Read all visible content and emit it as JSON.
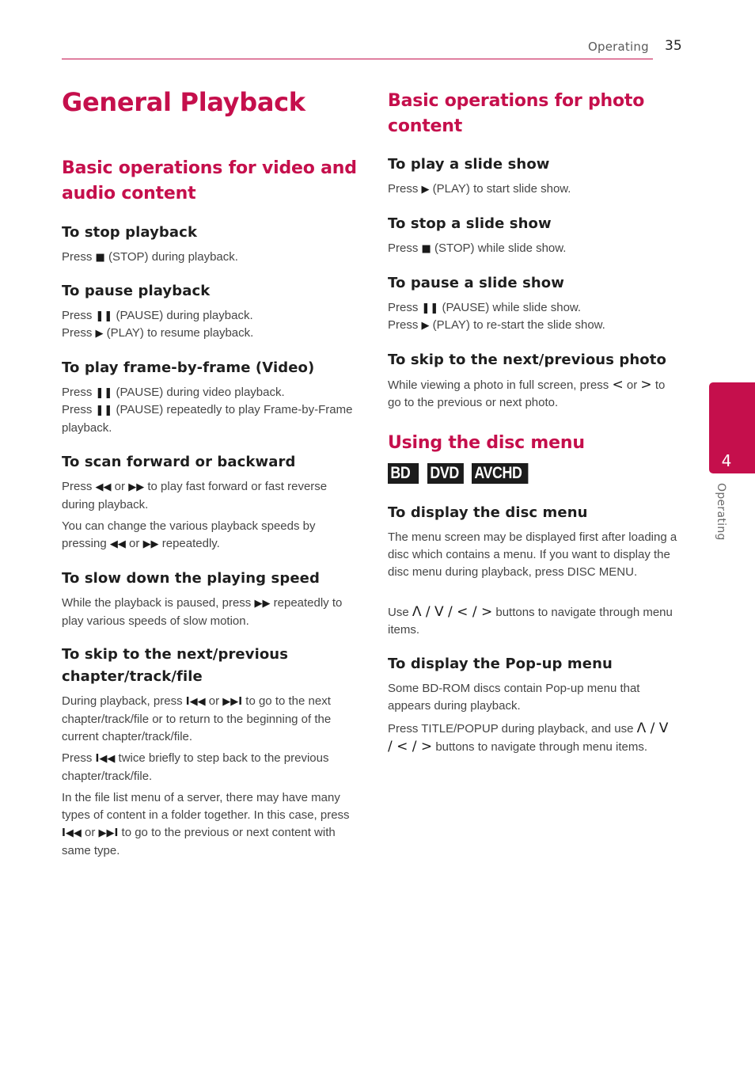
{
  "header": {
    "section": "Operating",
    "page_number": "35",
    "accent_color": "#c50f4c"
  },
  "title": "General Playback",
  "left": {
    "heading": "Basic operations for video and audio content",
    "sections": [
      {
        "title": "To stop playback",
        "paragraphs": [
          [
            {
              "t": "Press "
            },
            {
              "i": "stop-icon",
              "g": "■"
            },
            {
              "t": " (STOP) during playback."
            }
          ]
        ]
      },
      {
        "title": "To pause playback",
        "paragraphs": [
          [
            {
              "t": "Press "
            },
            {
              "i": "pause-icon",
              "g": "❚❚"
            },
            {
              "t": " (PAUSE) during playback."
            }
          ],
          [
            {
              "t": "Press "
            },
            {
              "i": "play-icon",
              "g": "▶"
            },
            {
              "t": " (PLAY) to resume playback."
            }
          ]
        ]
      },
      {
        "title": "To play frame-by-frame (Video)",
        "paragraphs": [
          [
            {
              "t": "Press "
            },
            {
              "i": "pause-icon",
              "g": "❚❚"
            },
            {
              "t": " (PAUSE) during video playback."
            }
          ],
          [
            {
              "t": "Press "
            },
            {
              "i": "pause-icon",
              "g": "❚❚"
            },
            {
              "t": " (PAUSE) repeatedly to play Frame-by-Frame playback."
            }
          ]
        ]
      },
      {
        "title": "To scan forward or backward",
        "paragraphs": [
          [
            {
              "t": "Press "
            },
            {
              "i": "rewind-icon",
              "g": "◀◀"
            },
            {
              "t": " or "
            },
            {
              "i": "fast-forward-icon",
              "g": "▶▶"
            },
            {
              "t": " to play fast forward or fast reverse during playback."
            }
          ],
          [
            {
              "t": "You can change the various playback speeds by pressing "
            },
            {
              "i": "rewind-icon",
              "g": "◀◀"
            },
            {
              "t": " or "
            },
            {
              "i": "fast-forward-icon",
              "g": "▶▶"
            },
            {
              "t": " repeatedly."
            }
          ]
        ]
      },
      {
        "title": "To slow down the playing speed",
        "paragraphs": [
          [
            {
              "t": "While the playback is paused, press "
            },
            {
              "i": "fast-forward-icon",
              "g": "▶▶"
            },
            {
              "t": " repeatedly to play various speeds of slow motion."
            }
          ]
        ]
      },
      {
        "title": "To skip to the next/previous chapter/track/file",
        "paragraphs": [
          [
            {
              "t": "During playback, press "
            },
            {
              "i": "skip-previous-icon",
              "g": "I◀◀"
            },
            {
              "t": " or "
            },
            {
              "i": "skip-next-icon",
              "g": "▶▶I"
            },
            {
              "t": " to go to the next chapter/track/file or to return to the beginning of the current chapter/track/file."
            }
          ],
          [
            {
              "t": "Press "
            },
            {
              "i": "skip-previous-icon",
              "g": "I◀◀"
            },
            {
              "t": " twice briefly to step back to the previous chapter/track/file."
            }
          ],
          [
            {
              "t": "In the file list menu of a server, there may have many types of content in a folder together. In this case, press "
            },
            {
              "i": "skip-previous-icon",
              "g": "I◀◀"
            },
            {
              "t": " or "
            },
            {
              "i": "skip-next-icon",
              "g": "▶▶I"
            },
            {
              "t": " to go to the previous or next content with same type."
            }
          ]
        ]
      }
    ]
  },
  "right": {
    "heading": "Basic operations for photo content",
    "sections": [
      {
        "title": "To play a slide show",
        "paragraphs": [
          [
            {
              "t": "Press "
            },
            {
              "i": "play-icon",
              "g": "▶"
            },
            {
              "t": " (PLAY) to start slide show."
            }
          ]
        ]
      },
      {
        "title": "To stop a slide show",
        "paragraphs": [
          [
            {
              "t": "Press "
            },
            {
              "i": "stop-icon",
              "g": "■"
            },
            {
              "t": " (STOP) while slide show."
            }
          ]
        ]
      },
      {
        "title": "To pause a slide show",
        "paragraphs": [
          [
            {
              "t": "Press "
            },
            {
              "i": "pause-icon",
              "g": "❚❚"
            },
            {
              "t": " (PAUSE) while slide show."
            }
          ],
          [
            {
              "t": "Press "
            },
            {
              "i": "play-icon",
              "g": "▶"
            },
            {
              "t": " (PLAY) to re-start the slide show."
            }
          ]
        ]
      },
      {
        "title": "To skip to the next/previous photo",
        "paragraphs": [
          [
            {
              "t": "While viewing a photo in full screen, press "
            },
            {
              "n": "left-arrow-icon",
              "g": "<"
            },
            {
              "t": " or "
            },
            {
              "n": "right-arrow-icon",
              "g": ">"
            },
            {
              "t": " to go to the previous or next photo."
            }
          ]
        ]
      }
    ],
    "disc_menu_heading": "Using the disc menu",
    "badges": [
      "BD",
      "DVD",
      "AVCHD"
    ],
    "disc_sections": [
      {
        "title": "To display the disc menu",
        "paragraphs": [
          [
            {
              "t": "The menu screen may be displayed first after loading a disc which contains a menu. If you want to display the disc menu during playback, press DISC MENU."
            }
          ],
          [
            {
              "t": "Use "
            },
            {
              "n": "nav-arrows-icon",
              "g": "Λ / V / < / >"
            },
            {
              "t": " buttons to navigate through menu items."
            }
          ]
        ]
      },
      {
        "title": "To display the Pop-up menu",
        "paragraphs": [
          [
            {
              "t": "Some BD-ROM discs contain Pop-up menu that appears during playback."
            }
          ],
          [
            {
              "t": "Press TITLE/POPUP during playback, and use "
            },
            {
              "n": "nav-arrows-icon",
              "g": "Λ / V / < / >"
            },
            {
              "t": " buttons to navigate through menu items."
            }
          ]
        ]
      }
    ]
  },
  "side_tab": {
    "chapter_number": "4",
    "label": "Operating"
  }
}
